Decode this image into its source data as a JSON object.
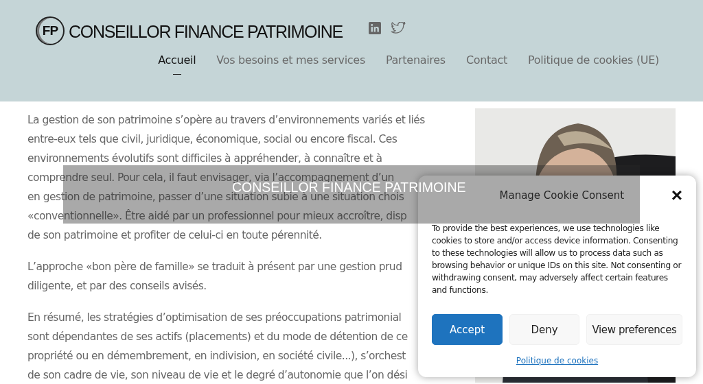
{
  "header": {
    "logo_mark": "FP",
    "site_title": "CONSEILLOR FINANCE PATRIMOINE",
    "social": [
      {
        "kind": "linkedin"
      },
      {
        "kind": "twitter"
      }
    ],
    "nav": [
      {
        "label": "Accueil",
        "selected": true
      },
      {
        "label": "Vos besoins et mes services",
        "selected": false
      },
      {
        "label": "Partenaires",
        "selected": false
      },
      {
        "label": "Contact",
        "selected": false
      },
      {
        "label": "Politique de cookies (UE)",
        "selected": false
      }
    ]
  },
  "content": {
    "paragraphs": [
      [
        "La gestion de son patrimoine s’opère au travers d’environnements variés et liés",
        "entre-eux tels que civil, juridique, économique, social ou encore fiscal. Ces",
        "environnements évolutifs sont difficiles à appréhender, à connaître et à",
        "comprendre seul. Pour cela, il faut envisager, via l’accompagnement d’un",
        "en gestion de patrimoine, passer d’une situation subie à une situation chois",
        "«conventionnelle». Être aidé par un professionnel pour mieux accroître, disp",
        "de son patrimoine et profiter de celui-ci en toute pérennité."
      ],
      [
        "L’approche «bon père de famille» se traduit à présent par une gestion prud",
        "diligente, et par des conseils avisés."
      ],
      [
        "En résumé, les stratégies d’optimisation de ses préoccupations patrimonial",
        "sont dépendantes de ses actifs (placements) et du mode de détention de ce",
        "propriété ou en démembrement, en indivision, en société civile...), s’orchest",
        "de son cadre de vie, son niveau de vie et le degré d’autonomie que l’on dési"
      ]
    ],
    "photo": {
      "kind": "picture"
    }
  },
  "banner": {
    "title": "CONSEILLOR FINANCE PATRIMOINE"
  },
  "cookie_dialog": {
    "title": "Manage Cookie Consent",
    "close": "×",
    "body": "To provide the best experiences, we use technologies like cookies to store and/or access device information. Consenting to these technologies will allow us to process data such as browsing behavior or unique IDs on this site. Not consenting or withdrawing consent, may adversely affect certain features and functions.",
    "buttons": [
      {
        "label": "Accept",
        "kind": "primary"
      },
      {
        "label": "Deny",
        "kind": "secondary"
      },
      {
        "label": "View preferences",
        "kind": "secondary"
      }
    ],
    "link": "Politique de cookies"
  }
}
